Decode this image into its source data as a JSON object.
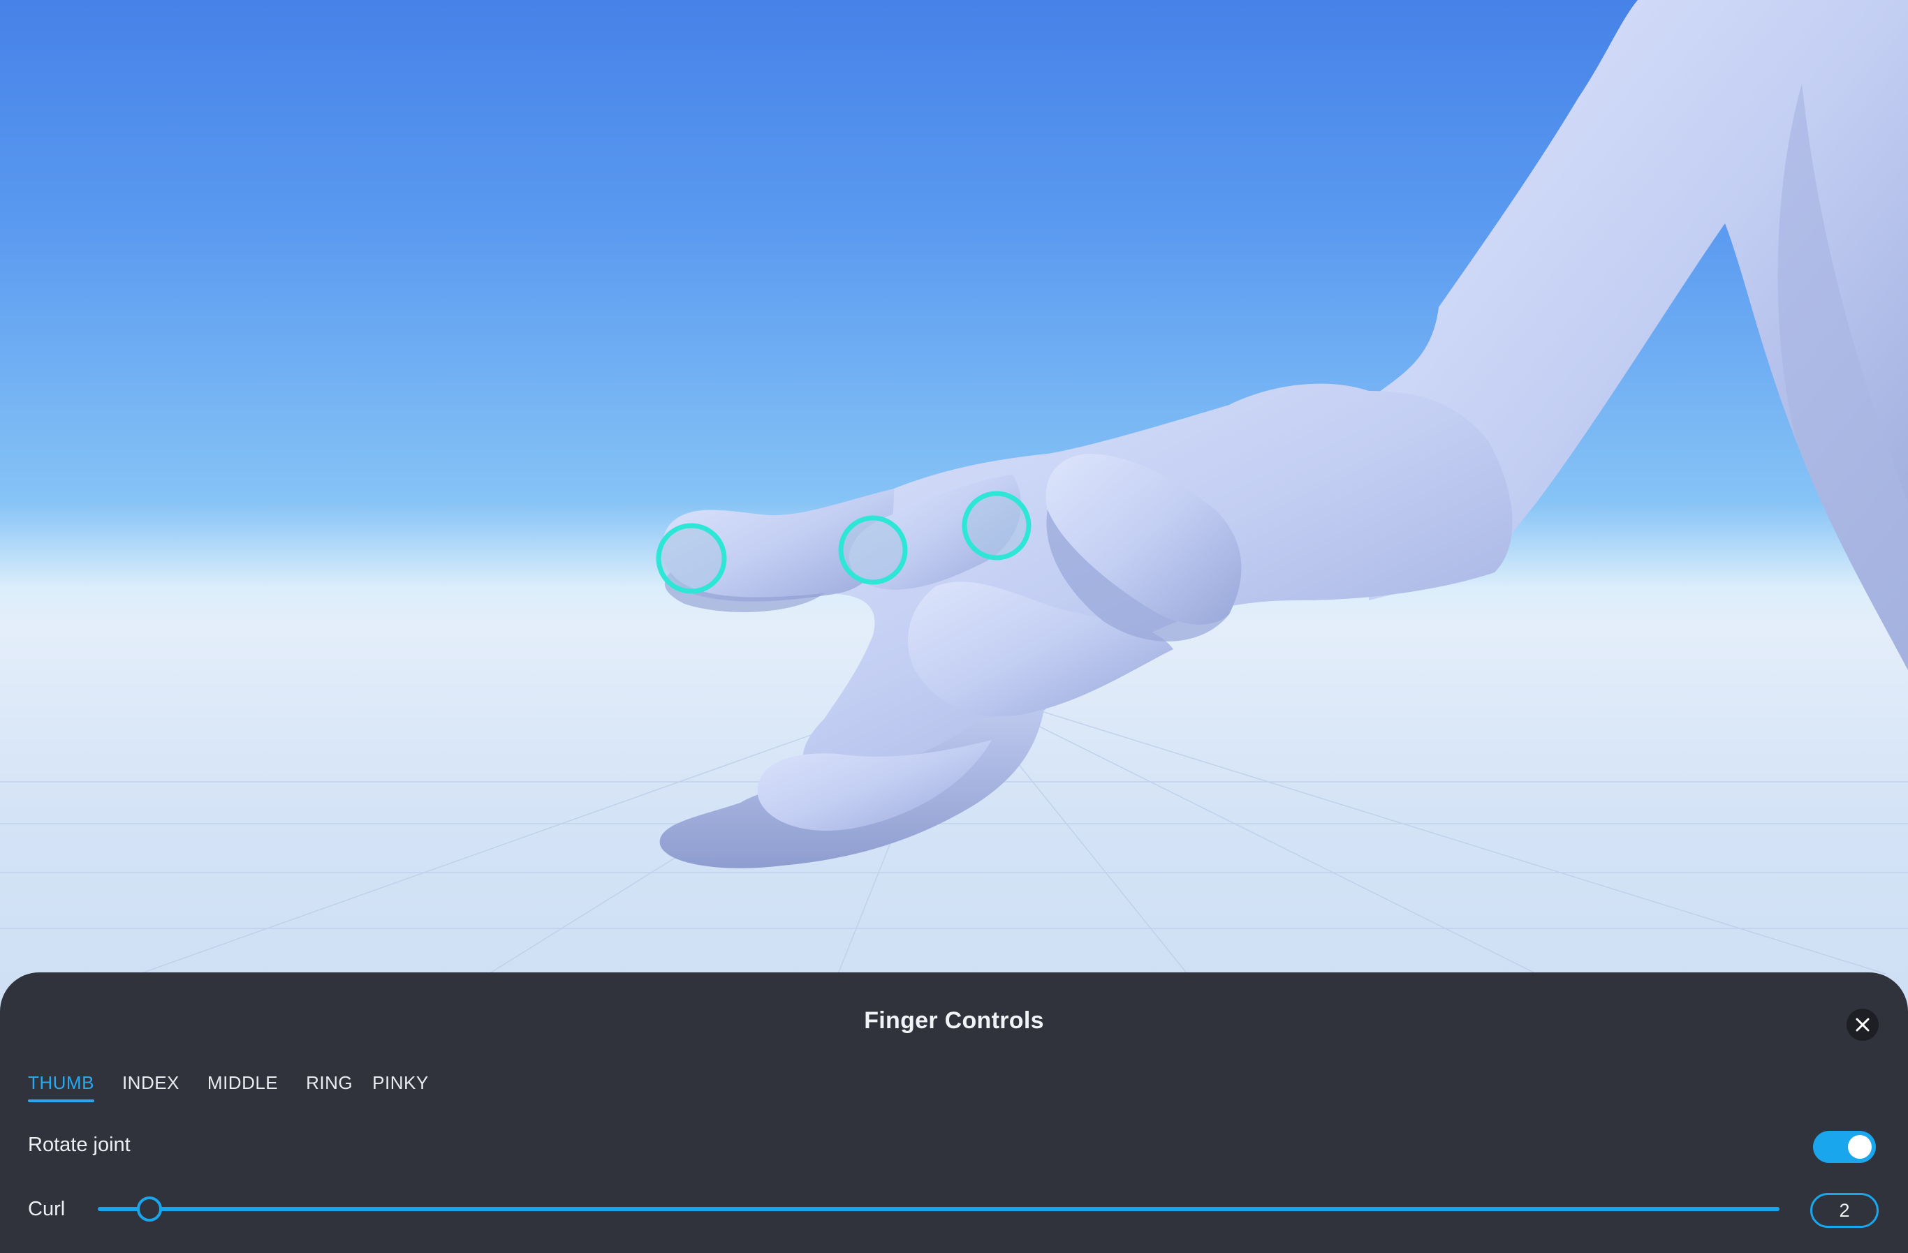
{
  "panel": {
    "title": "Finger Controls",
    "close_icon": "close-icon",
    "tabs": [
      {
        "label": "THUMB",
        "active": true
      },
      {
        "label": "INDEX",
        "active": false
      },
      {
        "label": "MIDDLE",
        "active": false
      },
      {
        "label": "RING",
        "active": false
      },
      {
        "label": "PINKY",
        "active": false
      }
    ],
    "rotate_joint": {
      "label": "Rotate joint",
      "enabled": true
    },
    "curl": {
      "label": "Curl",
      "value": "2"
    }
  },
  "viewport": {
    "joint_handles": 3,
    "accent_color": "#2ee6d6",
    "hand_color": "#c7d2f5"
  },
  "colors": {
    "accent": "#1aa6ec",
    "panel_bg": "#30333b"
  }
}
